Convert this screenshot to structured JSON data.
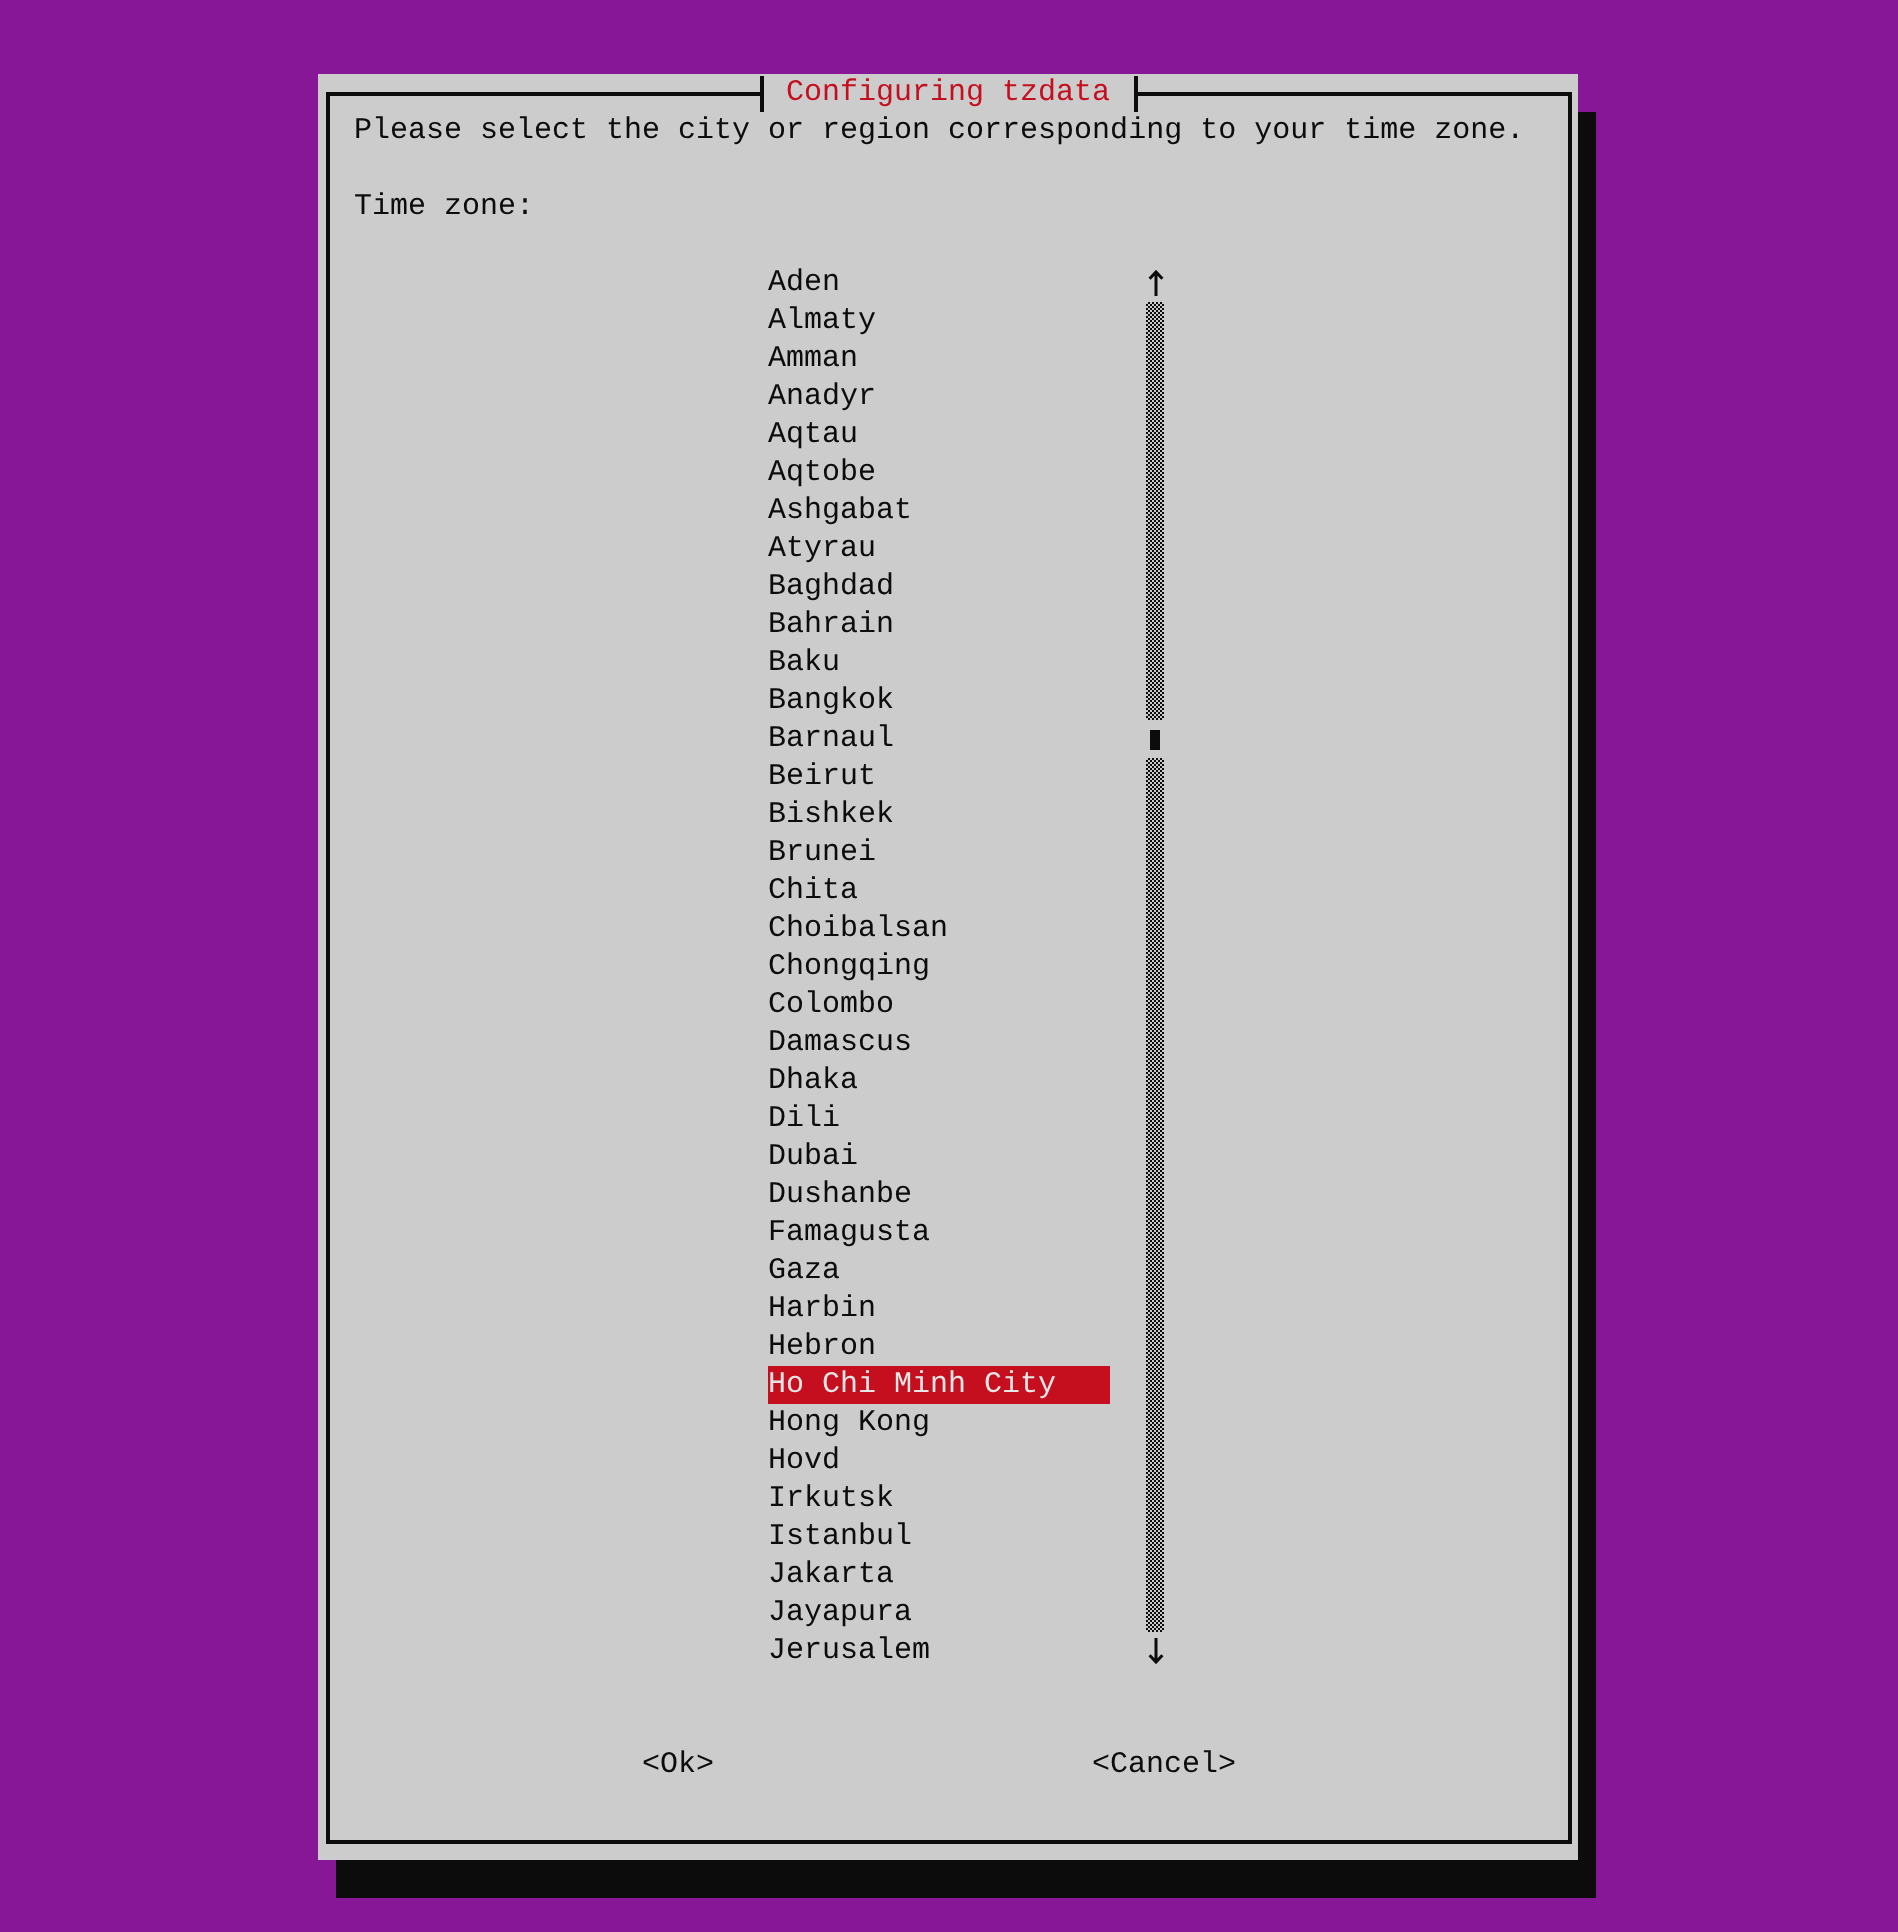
{
  "dialog": {
    "title": "Configuring tzdata",
    "prompt": "Please select the city or region corresponding to your time zone.",
    "list_label": "Time zone:",
    "timezones": [
      {
        "label": "Aden",
        "selected": false
      },
      {
        "label": "Almaty",
        "selected": false
      },
      {
        "label": "Amman",
        "selected": false
      },
      {
        "label": "Anadyr",
        "selected": false
      },
      {
        "label": "Aqtau",
        "selected": false
      },
      {
        "label": "Aqtobe",
        "selected": false
      },
      {
        "label": "Ashgabat",
        "selected": false
      },
      {
        "label": "Atyrau",
        "selected": false
      },
      {
        "label": "Baghdad",
        "selected": false
      },
      {
        "label": "Bahrain",
        "selected": false
      },
      {
        "label": "Baku",
        "selected": false
      },
      {
        "label": "Bangkok",
        "selected": false
      },
      {
        "label": "Barnaul",
        "selected": false
      },
      {
        "label": "Beirut",
        "selected": false
      },
      {
        "label": "Bishkek",
        "selected": false
      },
      {
        "label": "Brunei",
        "selected": false
      },
      {
        "label": "Chita",
        "selected": false
      },
      {
        "label": "Choibalsan",
        "selected": false
      },
      {
        "label": "Chongqing",
        "selected": false
      },
      {
        "label": "Colombo",
        "selected": false
      },
      {
        "label": "Damascus",
        "selected": false
      },
      {
        "label": "Dhaka",
        "selected": false
      },
      {
        "label": "Dili",
        "selected": false
      },
      {
        "label": "Dubai",
        "selected": false
      },
      {
        "label": "Dushanbe",
        "selected": false
      },
      {
        "label": "Famagusta",
        "selected": false
      },
      {
        "label": "Gaza",
        "selected": false
      },
      {
        "label": "Harbin",
        "selected": false
      },
      {
        "label": "Hebron",
        "selected": false
      },
      {
        "label": "Ho Chi Minh City",
        "selected": true
      },
      {
        "label": "Hong Kong",
        "selected": false
      },
      {
        "label": "Hovd",
        "selected": false
      },
      {
        "label": "Irkutsk",
        "selected": false
      },
      {
        "label": "Istanbul",
        "selected": false
      },
      {
        "label": "Jakarta",
        "selected": false
      },
      {
        "label": "Jayapura",
        "selected": false
      },
      {
        "label": "Jerusalem",
        "selected": false
      }
    ],
    "buttons": [
      {
        "label": "<Ok>"
      },
      {
        "label": "<Cancel>"
      }
    ]
  }
}
